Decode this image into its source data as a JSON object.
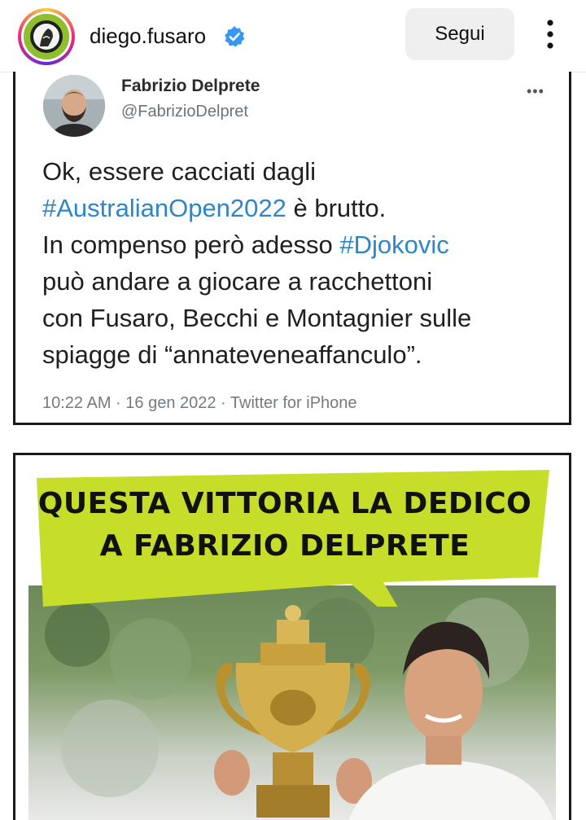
{
  "header": {
    "username": "diego.fusaro",
    "follow_label": "Segui",
    "icons": {
      "avatar": "profile-avatar",
      "verified": "verified-badge-icon",
      "more": "more-vertical-icon"
    }
  },
  "tweet": {
    "author_name": "Fabrizio Delprete",
    "author_handle": "@FabrizioDelpret",
    "text_lines": [
      {
        "before": "Ok, essere cacciati dagli",
        "hash": "",
        "after": ""
      },
      {
        "before": "",
        "hash": "#AustralianOpen2022",
        "after": " è brutto."
      },
      {
        "before": "In compenso però adesso ",
        "hash": "#Djokovic",
        "after": ""
      },
      {
        "before": "può andare a giocare a racchettoni",
        "hash": "",
        "after": ""
      },
      {
        "before": "con Fusaro, Becchi e Montagnier sulle",
        "hash": "",
        "after": ""
      },
      {
        "before": "spiagge di “annateveneaffanculo”.",
        "hash": "",
        "after": ""
      }
    ],
    "meta": "10:22 AM · 16 gen 2022 · Twitter for iPhone",
    "more_glyph": "•••"
  },
  "meme": {
    "banner_line1": "QUESTA VITTORIA LA DEDICO",
    "banner_line2": "A FABRIZIO DELPRETE",
    "colors": {
      "banner": "#c6de2a",
      "hashtag": "#2d86c8"
    }
  }
}
